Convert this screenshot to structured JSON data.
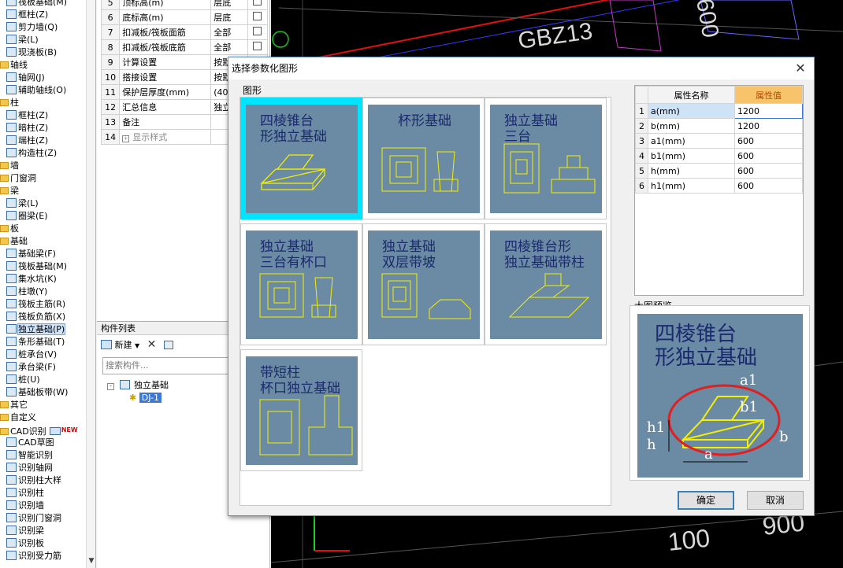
{
  "left_tree": [
    {
      "label": "筏板基础(M)",
      "icon": "raft-icon"
    },
    {
      "label": "框柱(Z)",
      "icon": "column-icon"
    },
    {
      "label": "剪力墙(Q)",
      "icon": "wall-icon"
    },
    {
      "label": "梁(L)",
      "icon": "beam-icon"
    },
    {
      "label": "现浇板(B)",
      "icon": "slab-icon"
    },
    {
      "label": "轴线",
      "icon": "folder-icon",
      "folder": true
    },
    {
      "label": "轴网(J)",
      "icon": "grid-icon"
    },
    {
      "label": "辅助轴线(O)",
      "icon": "aux-axis-icon"
    },
    {
      "label": "柱",
      "icon": "folder-icon",
      "folder": true
    },
    {
      "label": "框柱(Z)",
      "icon": "column-icon"
    },
    {
      "label": "暗柱(Z)",
      "icon": "column-icon"
    },
    {
      "label": "端柱(Z)",
      "icon": "column-icon"
    },
    {
      "label": "构造柱(Z)",
      "icon": "column-icon"
    },
    {
      "label": "墙",
      "icon": "folder-icon",
      "folder": true
    },
    {
      "label": "门窗洞",
      "icon": "folder-icon",
      "folder": true
    },
    {
      "label": "梁",
      "icon": "folder-icon",
      "folder": true
    },
    {
      "label": "梁(L)",
      "icon": "beam-icon"
    },
    {
      "label": "圈梁(E)",
      "icon": "beam-icon"
    },
    {
      "label": "板",
      "icon": "folder-icon",
      "folder": true
    },
    {
      "label": "基础",
      "icon": "folder-icon",
      "folder": true
    },
    {
      "label": "基础梁(F)",
      "icon": "beam-icon"
    },
    {
      "label": "筏板基础(M)",
      "icon": "raft-icon"
    },
    {
      "label": "集水坑(K)",
      "icon": "pit-icon"
    },
    {
      "label": "柱墩(Y)",
      "icon": "pier-icon"
    },
    {
      "label": "筏板主筋(R)",
      "icon": "rebar-icon"
    },
    {
      "label": "筏板负筋(X)",
      "icon": "rebar-icon"
    },
    {
      "label": "独立基础(P)",
      "icon": "footing-icon",
      "selected": true
    },
    {
      "label": "条形基础(T)",
      "icon": "strip-icon"
    },
    {
      "label": "桩承台(V)",
      "icon": "pile-cap-icon"
    },
    {
      "label": "承台梁(F)",
      "icon": "beam-icon"
    },
    {
      "label": "桩(U)",
      "icon": "pile-icon"
    },
    {
      "label": "基础板带(W)",
      "icon": "strip-icon"
    },
    {
      "label": "其它",
      "icon": "folder-icon",
      "folder": true
    },
    {
      "label": "自定义",
      "icon": "folder-icon",
      "folder": true
    },
    {
      "label": "CAD识别",
      "icon": "folder-icon",
      "folder": true,
      "badge": "NEW"
    },
    {
      "label": "CAD草图",
      "icon": "cad-icon"
    },
    {
      "label": "智能识别",
      "icon": "cad-icon"
    },
    {
      "label": "识别轴网",
      "icon": "cad-icon"
    },
    {
      "label": "识别柱大样",
      "icon": "cad-icon"
    },
    {
      "label": "识别柱",
      "icon": "cad-icon"
    },
    {
      "label": "识别墙",
      "icon": "cad-icon"
    },
    {
      "label": "识别门窗洞",
      "icon": "cad-icon"
    },
    {
      "label": "识别梁",
      "icon": "cad-icon"
    },
    {
      "label": "识别板",
      "icon": "cad-icon"
    },
    {
      "label": "识别受力筋",
      "icon": "cad-icon"
    }
  ],
  "props_table": [
    {
      "n": "5",
      "name": "顶标高(m)",
      "val": "层底"
    },
    {
      "n": "6",
      "name": "底标高(m)",
      "val": "层底"
    },
    {
      "n": "7",
      "name": "扣减板/筏板面筋",
      "val": "全部"
    },
    {
      "n": "8",
      "name": "扣减板/筏板底筋",
      "val": "全部"
    },
    {
      "n": "9",
      "name": "计算设置",
      "val": "按默"
    },
    {
      "n": "10",
      "name": "搭接设置",
      "val": "按默"
    },
    {
      "n": "11",
      "name": "保护层厚度(mm)",
      "val": "(40"
    },
    {
      "n": "12",
      "name": "汇总信息",
      "val": "独立"
    },
    {
      "n": "13",
      "name": "备注",
      "val": ""
    },
    {
      "n": "14",
      "name": "显示样式",
      "val": ""
    }
  ],
  "component_list": {
    "header": "构件列表",
    "new_label": "新建",
    "search_placeholder": "搜索构件...",
    "tree_root": "独立基础",
    "tree_child": "DJ-1"
  },
  "cad_labels": {
    "gbz": "GBZ13",
    "n600": "600",
    "n100": "100",
    "n900": "900"
  },
  "dialog": {
    "title": "选择参数化图形",
    "group_label": "图形",
    "preview_label": "大图预览",
    "ok": "确定",
    "cancel": "取消",
    "param_headers": [
      "属性名称",
      "属性值"
    ],
    "params": [
      {
        "row": "1",
        "name": "a(mm)",
        "value": "1200"
      },
      {
        "row": "2",
        "name": "b(mm)",
        "value": "1200"
      },
      {
        "row": "3",
        "name": "a1(mm)",
        "value": "600"
      },
      {
        "row": "4",
        "name": "b1(mm)",
        "value": "600"
      },
      {
        "row": "5",
        "name": "h(mm)",
        "value": "600"
      },
      {
        "row": "6",
        "name": "h1(mm)",
        "value": "600"
      }
    ],
    "shapes": [
      {
        "id": "shape-1",
        "l1": "四棱锥台",
        "l2": "形独立基础",
        "selected": true
      },
      {
        "id": "shape-2",
        "l1": "杯形基础",
        "l2": ""
      },
      {
        "id": "shape-3",
        "l1": "独立基础",
        "l2": "三台"
      },
      {
        "id": "shape-4",
        "l1": "独立基础",
        "l2": "三台有杯口"
      },
      {
        "id": "shape-5",
        "l1": "独立基础",
        "l2": "双层带坡"
      },
      {
        "id": "shape-6",
        "l1": "四棱锥台形",
        "l2": "独立基础带柱"
      },
      {
        "id": "shape-7",
        "l1": "带短柱",
        "l2": "杯口独立基础"
      }
    ],
    "preview": {
      "l1": "四棱锥台",
      "l2": "形独立基础",
      "dims": {
        "a": "a",
        "b": "b",
        "a1": "a1",
        "b1": "b1",
        "h": "h",
        "h1": "h1"
      }
    }
  },
  "colors": {
    "tile_bg": "#6b8aa3",
    "drawing": "#f5f000",
    "title_text": "#1a2a6e",
    "selection": "#00e5ff",
    "highlight_circle": "#e02020"
  }
}
